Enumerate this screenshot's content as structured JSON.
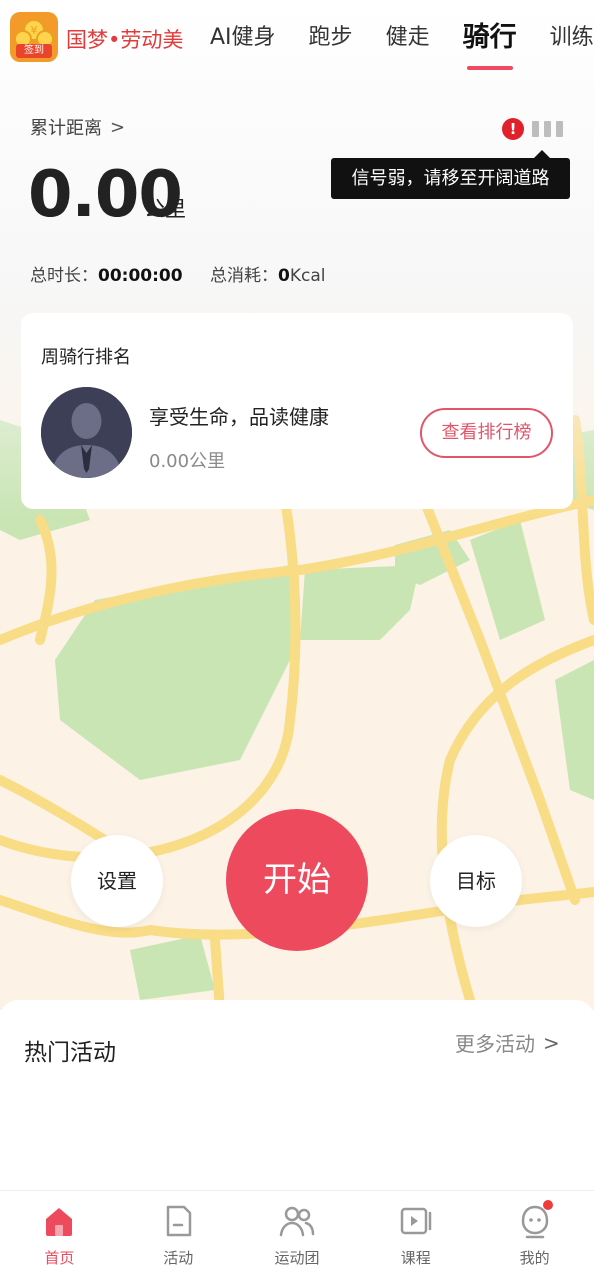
{
  "header": {
    "sign_badge_label": "签到",
    "brand": "国梦•劳动美",
    "tabs": [
      {
        "label": "AI健身",
        "active": false
      },
      {
        "label": "跑步",
        "active": false
      },
      {
        "label": "健走",
        "active": false
      },
      {
        "label": "骑行",
        "active": true
      },
      {
        "label": "训练",
        "active": false
      }
    ]
  },
  "stats": {
    "distance_label": "累计距离",
    "distance_value": "0.00",
    "distance_unit": "公里",
    "total_time_label": "总时长：",
    "total_time_value": "00:00:00",
    "total_cal_label": "总消耗：",
    "total_cal_value": "0",
    "total_cal_unit": "Kcal"
  },
  "signal": {
    "warning_glyph": "!",
    "tooltip": "信号弱，请移至开阔道路"
  },
  "ranking": {
    "title": "周骑行排名",
    "motto": "享受生命，品读健康",
    "distance": "0.00公里",
    "button": "查看排行榜"
  },
  "controls": {
    "settings": "设置",
    "start": "开始",
    "goal": "目标"
  },
  "hot": {
    "title": "热门活动",
    "more": "更多活动"
  },
  "nav": {
    "items": [
      {
        "label": "首页",
        "icon": "home-icon",
        "active": true
      },
      {
        "label": "活动",
        "icon": "activity-icon",
        "active": false
      },
      {
        "label": "运动团",
        "icon": "group-icon",
        "active": false
      },
      {
        "label": "课程",
        "icon": "video-icon",
        "active": false
      },
      {
        "label": "我的",
        "icon": "profile-icon",
        "active": false
      }
    ]
  },
  "colors": {
    "accent": "#ee4a5e",
    "brand_red": "#e23b3b",
    "map_bg": "#fcf3e6",
    "map_park": "#c9e5b3",
    "map_road": "#f9dc86"
  }
}
